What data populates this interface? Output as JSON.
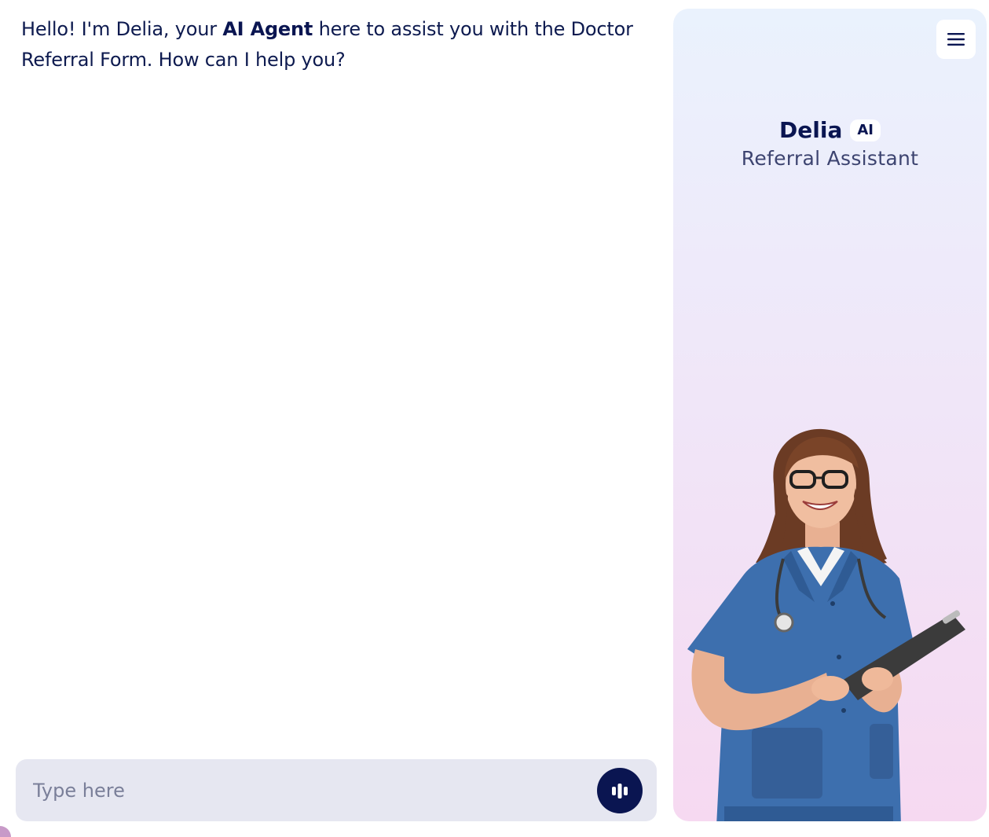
{
  "chat": {
    "greeting_prefix": "Hello! I'm Delia, your ",
    "greeting_bold": "AI Agent",
    "greeting_suffix": " here to assist you with the Doctor Referral Form. How can I help you?",
    "input": {
      "placeholder": "Type here",
      "value": ""
    },
    "voice_button_icon": "audio-wave-icon"
  },
  "panel": {
    "agent_name": "Delia",
    "ai_badge": "AI",
    "agent_role": "Referral Assistant",
    "menu_icon": "hamburger-menu-icon"
  },
  "colors": {
    "primary": "#0a1551",
    "input_background": "#e6e7f1",
    "panel_gradient_top": "#eaf2fd",
    "panel_gradient_bottom": "#f6d9f1",
    "scrubs": "#3d6fae"
  }
}
